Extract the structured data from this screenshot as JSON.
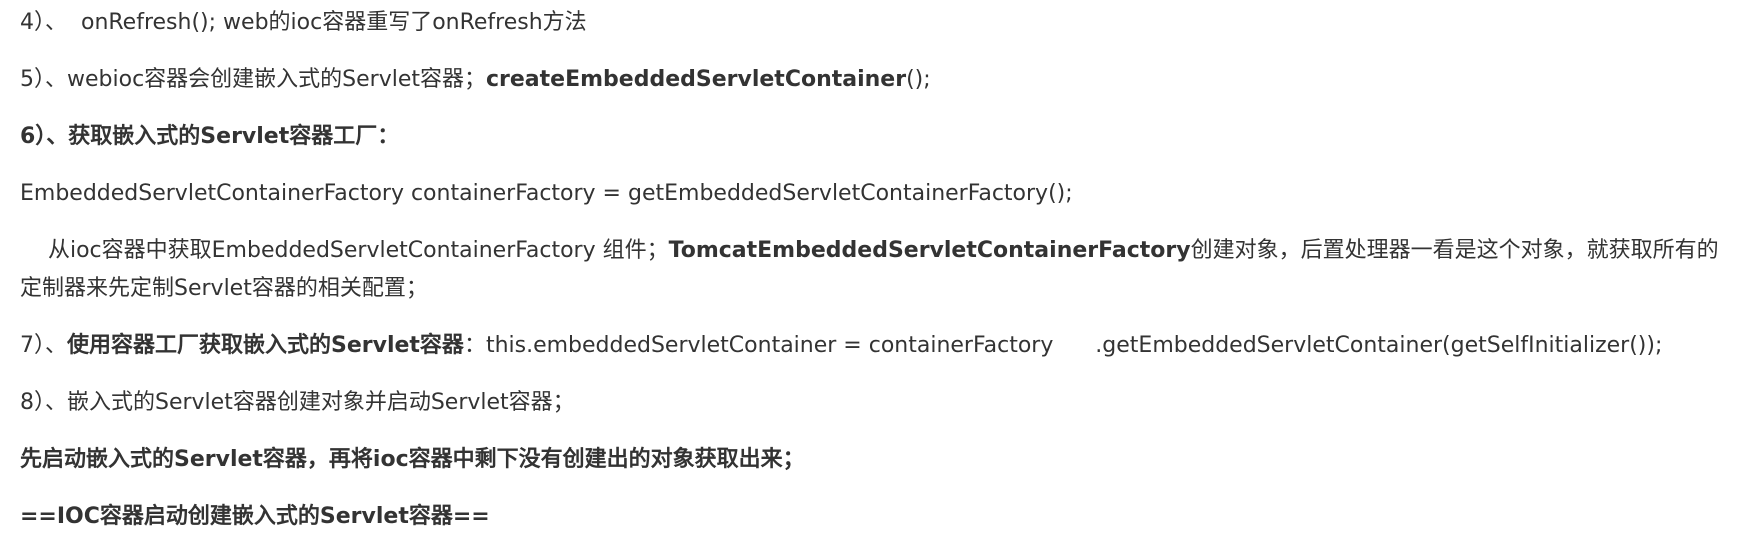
{
  "paragraphs": {
    "p4": {
      "text": "4）、  onRefresh(); web的ioc容器重写了onRefresh方法"
    },
    "p5": {
      "a": "5）、webioc容器会创建嵌入式的Servlet容器；",
      "b": "createEmbeddedServletContainer",
      "c": "();"
    },
    "p6": {
      "text": "6）、获取嵌入式的Servlet容器工厂："
    },
    "p6_code": {
      "text": "EmbeddedServletContainerFactory containerFactory = getEmbeddedServletContainerFactory();"
    },
    "p6_desc": {
      "a": "    从ioc容器中获取EmbeddedServletContainerFactory 组件；",
      "b": "TomcatEmbeddedServletContainerFactory",
      "c": "创建对象，后置处理器一看是这个对象，就获取所有的定制器来先定制Servlet容器的相关配置；"
    },
    "p7": {
      "a": "7）、",
      "b": "使用容器工厂获取嵌入式的Servlet容器",
      "c": "：this.embeddedServletContainer = containerFactory      .getEmbeddedServletContainer(getSelfInitializer());"
    },
    "p8": {
      "text": "8）、嵌入式的Servlet容器创建对象并启动Servlet容器；"
    },
    "p9": {
      "text": "先启动嵌入式的Servlet容器，再将ioc容器中剩下没有创建出的对象获取出来；"
    },
    "p10": {
      "text": "==IOC容器启动创建嵌入式的Servlet容器=="
    }
  }
}
